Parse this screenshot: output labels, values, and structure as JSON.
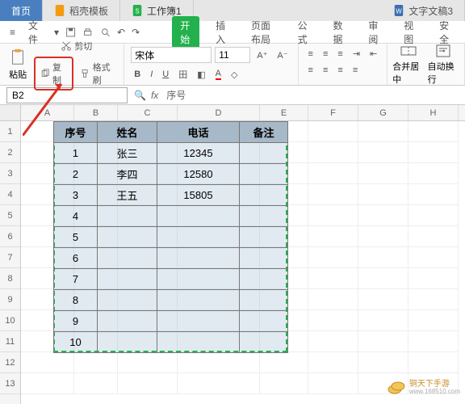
{
  "tabs": [
    {
      "label": "首页",
      "active": true
    },
    {
      "label": "稻壳模板",
      "icon": "doc-orange"
    },
    {
      "label": "工作簿1",
      "icon": "xls-green"
    },
    {
      "label": "文字文稿3",
      "icon": "doc-blue"
    }
  ],
  "menubar": {
    "file": "文件",
    "ribbons": [
      "开始",
      "插入",
      "页面布局",
      "公式",
      "数据",
      "审阅",
      "视图",
      "安全"
    ]
  },
  "clipboard": {
    "paste": "粘贴",
    "cut": "剪切",
    "copy": "复制",
    "format_painter": "格式刷"
  },
  "font": {
    "name": "宋体",
    "size": "11"
  },
  "alignment": {
    "merge": "合并居中",
    "wrap": "自动换行"
  },
  "name_box": "B2",
  "formula": "序号",
  "columns": [
    "A",
    "B",
    "C",
    "D",
    "E",
    "F",
    "G",
    "H"
  ],
  "row_count": 13,
  "table": {
    "headers": [
      "序号",
      "姓名",
      "电话",
      "备注"
    ],
    "rows": [
      {
        "n": "1",
        "name": "张三",
        "tel": "12345",
        "note": ""
      },
      {
        "n": "2",
        "name": "李四",
        "tel": "12580",
        "note": ""
      },
      {
        "n": "3",
        "name": "王五",
        "tel": "15805",
        "note": ""
      },
      {
        "n": "4",
        "name": "",
        "tel": "",
        "note": ""
      },
      {
        "n": "5",
        "name": "",
        "tel": "",
        "note": ""
      },
      {
        "n": "6",
        "name": "",
        "tel": "",
        "note": ""
      },
      {
        "n": "7",
        "name": "",
        "tel": "",
        "note": ""
      },
      {
        "n": "8",
        "name": "",
        "tel": "",
        "note": ""
      },
      {
        "n": "9",
        "name": "",
        "tel": "",
        "note": ""
      },
      {
        "n": "10",
        "name": "",
        "tel": "",
        "note": ""
      }
    ]
  },
  "watermark": {
    "line1": "铜天下手游",
    "line2": "www.168510.com"
  }
}
